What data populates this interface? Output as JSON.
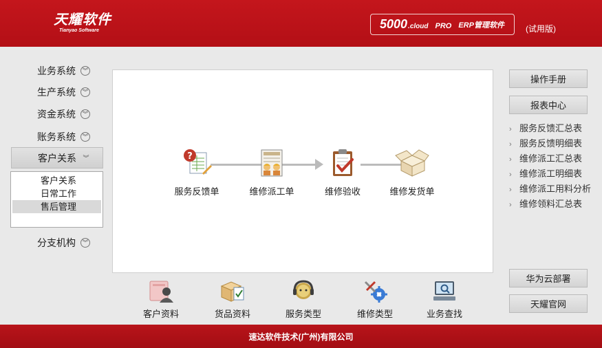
{
  "header": {
    "logo_cn": "天耀软件",
    "logo_en": "Tianyao Software",
    "product_number": "5000",
    "product_cloud": ".cloud",
    "product_edition": "PRO",
    "product_name": "ERP管理软件",
    "trial_label": "(试用版)"
  },
  "nav": {
    "items": [
      {
        "label": "业务系统",
        "icon": "chevron-down-circle-icon"
      },
      {
        "label": "生产系统",
        "icon": "chevron-down-circle-icon"
      },
      {
        "label": "资金系统",
        "icon": "chevron-down-circle-icon"
      },
      {
        "label": "账务系统",
        "icon": "chevron-down-circle-icon"
      },
      {
        "label": "客户关系",
        "icon": "chevron-down-icon",
        "expanded": true
      },
      {
        "label": "分支机构",
        "icon": "chevron-down-circle-icon"
      }
    ],
    "submenu": [
      "客户关系",
      "日常工作",
      "售后管理"
    ],
    "submenu_selected": "售后管理"
  },
  "flow": {
    "steps": [
      {
        "label": "服务反馈单",
        "icon": "feedback-form-icon"
      },
      {
        "label": "维修派工单",
        "icon": "dispatch-order-icon"
      },
      {
        "label": "维修验收",
        "icon": "clipboard-check-icon"
      },
      {
        "label": "维修发货单",
        "icon": "shipping-box-icon"
      }
    ]
  },
  "bottom_bar": {
    "items": [
      {
        "label": "客户资料",
        "icon": "customer-profile-icon"
      },
      {
        "label": "货品资料",
        "icon": "goods-data-icon"
      },
      {
        "label": "服务类型",
        "icon": "service-headset-icon"
      },
      {
        "label": "维修类型",
        "icon": "repair-tools-icon"
      },
      {
        "label": "业务查找",
        "icon": "business-search-icon"
      }
    ]
  },
  "right_panel": {
    "manual_button": "操作手册",
    "report_center_button": "报表中心",
    "reports": [
      "服务反馈汇总表",
      "服务反馈明细表",
      "维修派工汇总表",
      "维修派工明细表",
      "维修派工用料分析",
      "维修领料汇总表"
    ],
    "huawei_button": "华为云部署",
    "official_site_button": "天耀官网"
  },
  "footer": {
    "company": "速达软件技术(广州)有限公司"
  },
  "colors": {
    "brand_red": "#c4161c",
    "background": "#e9e9e9",
    "panel": "#ffffff"
  }
}
